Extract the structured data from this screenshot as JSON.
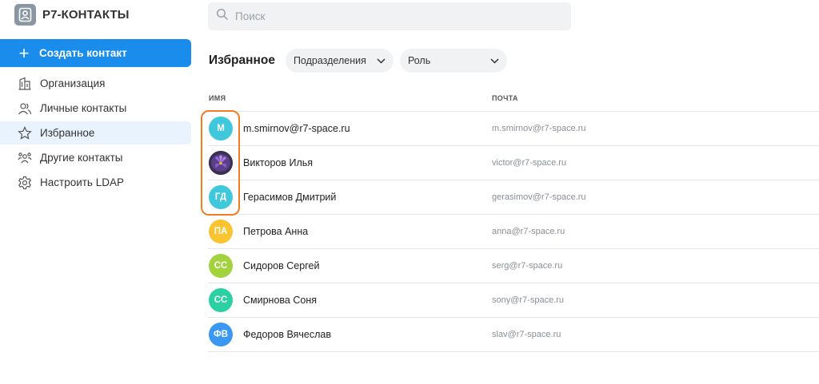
{
  "app": {
    "title": "Р7-КОНТАКТЫ"
  },
  "sidebar": {
    "create_label": "Создать контакт",
    "items": [
      {
        "label": "Организация",
        "icon": "building-icon",
        "active": false
      },
      {
        "label": "Личные контакты",
        "icon": "contacts-icon",
        "active": false
      },
      {
        "label": "Избранное",
        "icon": "star-icon",
        "active": true
      },
      {
        "label": "Другие контакты",
        "icon": "group-icon",
        "active": false
      },
      {
        "label": "Настроить LDAP",
        "icon": "gear-icon",
        "active": false
      }
    ]
  },
  "search": {
    "placeholder": "Поиск",
    "value": ""
  },
  "main": {
    "title": "Избранное",
    "filters": {
      "departments": "Подразделения",
      "role": "Роль"
    },
    "columns": {
      "name": "ИМЯ",
      "email": "ПОЧТА"
    },
    "rows": [
      {
        "initials": "М",
        "name": "m.smirnov@r7-space.ru",
        "email": "m.smirnov@r7-space.ru",
        "color": "#3fc7dc",
        "photo": false
      },
      {
        "initials": "",
        "name": "Викторов Илья",
        "email": "victor@r7-space.ru",
        "color": "#6a4d9c",
        "photo": true
      },
      {
        "initials": "ГД",
        "name": "Герасимов Дмитрий",
        "email": "gerasimov@r7-space.ru",
        "color": "#3fc7dc",
        "photo": false
      },
      {
        "initials": "ПА",
        "name": "Петрова Анна",
        "email": "anna@r7-space.ru",
        "color": "#f9c42f",
        "photo": false
      },
      {
        "initials": "СС",
        "name": "Сидоров Сергей",
        "email": "serg@r7-space.ru",
        "color": "#a3d23f",
        "photo": false
      },
      {
        "initials": "СС",
        "name": "Смирнова Соня",
        "email": "sony@r7-space.ru",
        "color": "#2bd1a0",
        "photo": false
      },
      {
        "initials": "ФВ",
        "name": "Федоров Вячеслав",
        "email": "slav@r7-space.ru",
        "color": "#3a98f2",
        "photo": false
      }
    ]
  },
  "colors": {
    "accent": "#1a8cec",
    "active_bg": "#e9f3fd",
    "highlight": "#f07d23"
  }
}
